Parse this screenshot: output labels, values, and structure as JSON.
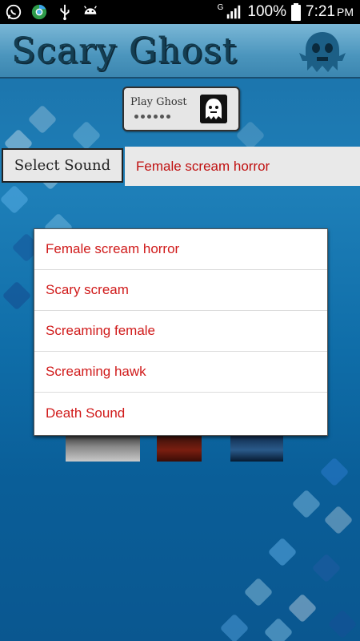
{
  "status_bar": {
    "battery": "100%",
    "time": "7:21",
    "ampm": "PM",
    "network": "G",
    "icons": [
      "whatsapp-icon",
      "chrome-icon",
      "usb-icon",
      "android-icon",
      "signal-icon",
      "battery-icon"
    ]
  },
  "header": {
    "title": "Scary Ghost",
    "logo_icon": "ghost-icon"
  },
  "play_button": {
    "label": "Play Ghost",
    "icon": "ghost-icon"
  },
  "sound_selector": {
    "button_label": "Select Sound",
    "selected_value": "Female scream horror"
  },
  "dropdown": {
    "items": [
      {
        "label": "Female scream horror"
      },
      {
        "label": "Scary scream"
      },
      {
        "label": "Screaming female"
      },
      {
        "label": "Screaming hawk"
      },
      {
        "label": "Death Sound"
      }
    ]
  },
  "colors": {
    "accent_text": "#d01a1a",
    "background": "#1e7fb8",
    "header_title": "#143e52"
  }
}
